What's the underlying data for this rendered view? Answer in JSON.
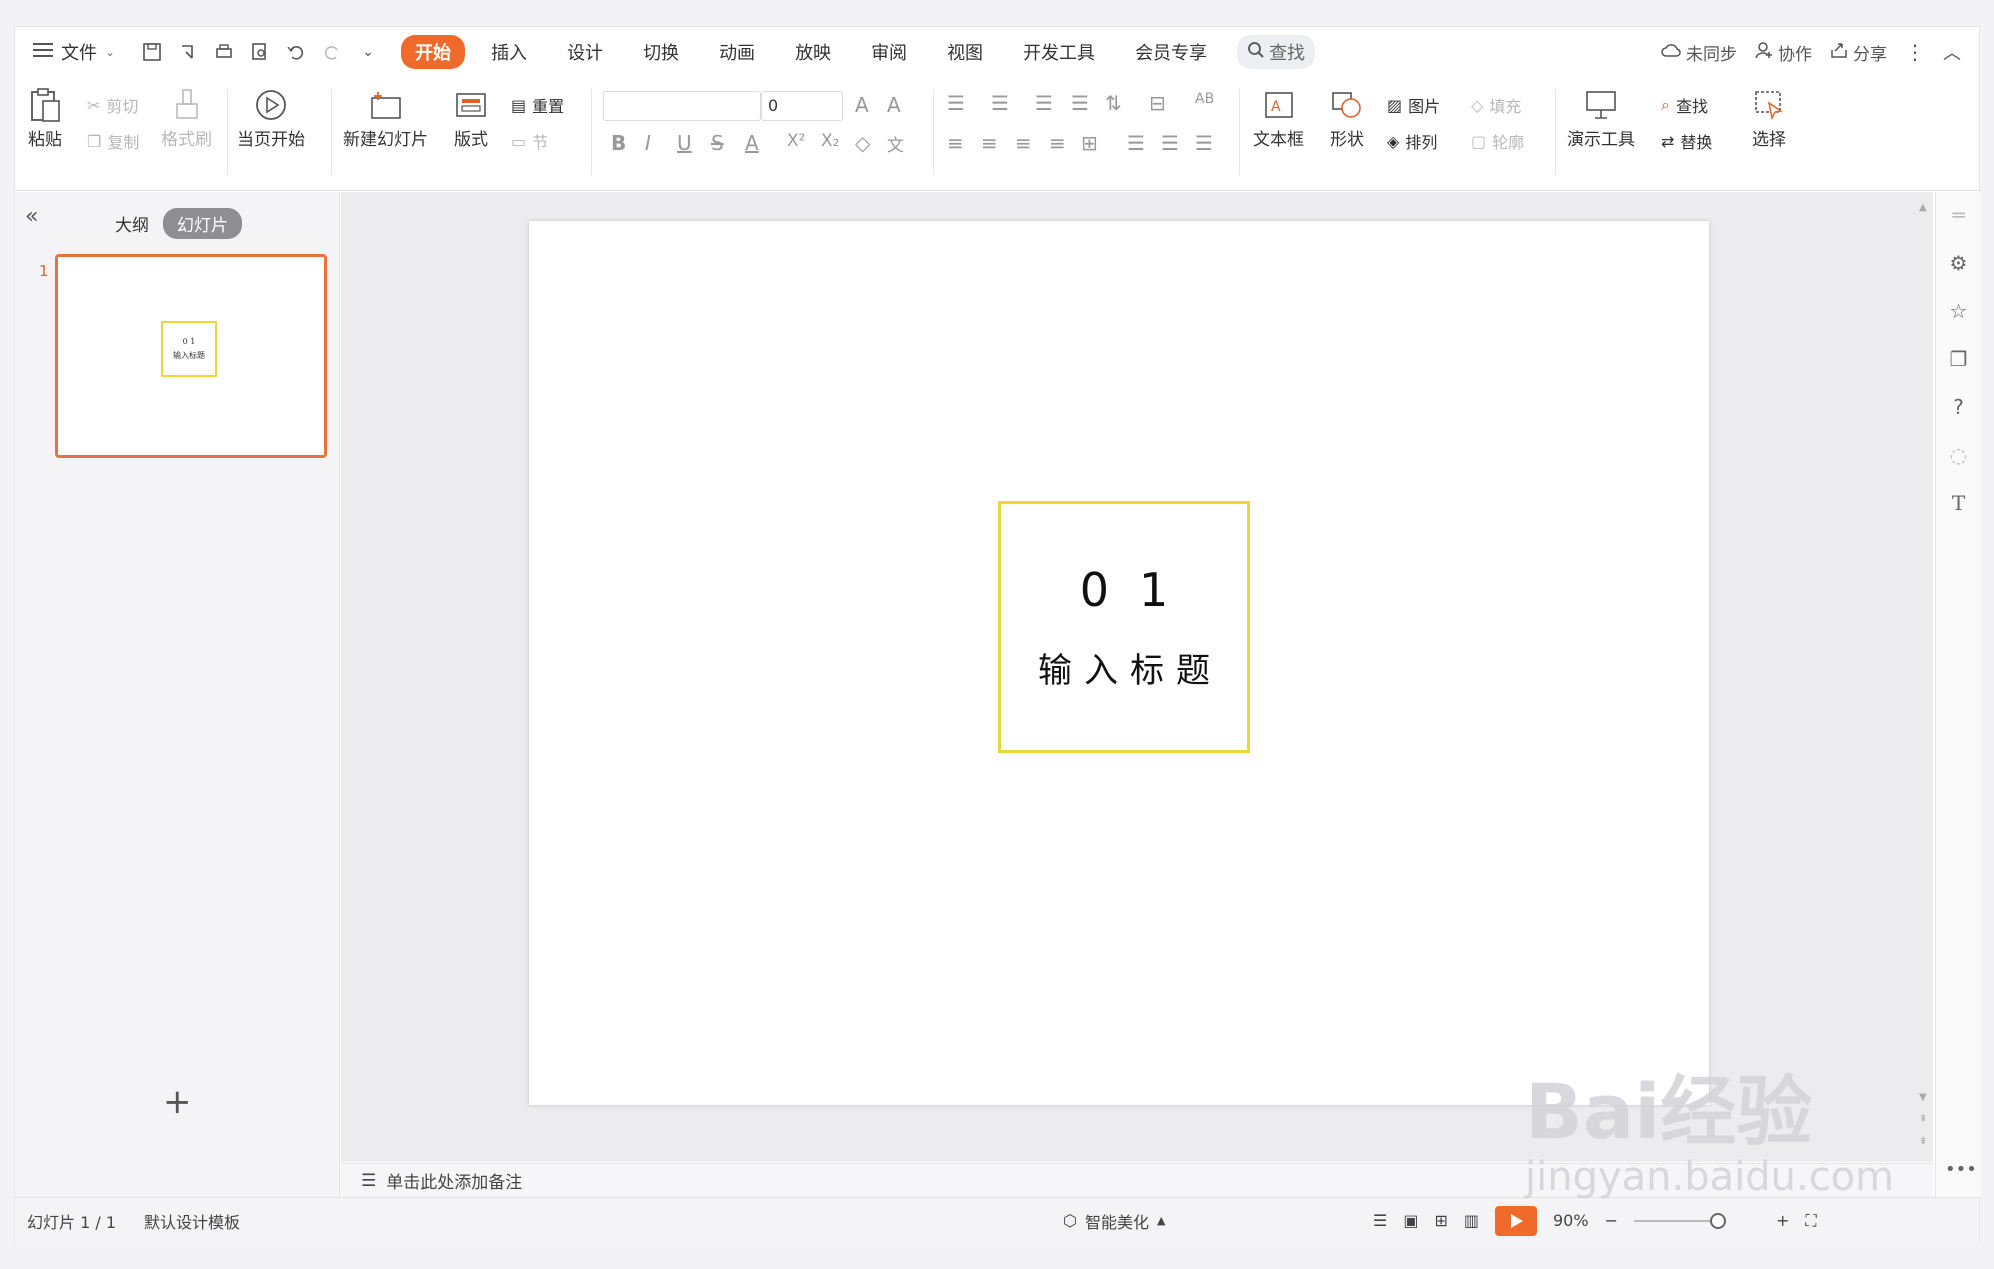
{
  "menubar": {
    "file_label": "文件",
    "tabs": [
      "开始",
      "插入",
      "设计",
      "切换",
      "动画",
      "放映",
      "审阅",
      "视图",
      "开发工具",
      "会员专享"
    ],
    "search_label": "查找",
    "right": {
      "sync": "未同步",
      "collab": "协作",
      "share": "分享"
    }
  },
  "ribbon": {
    "paste": "粘贴",
    "cut": "剪切",
    "copy": "复制",
    "format_painter": "格式刷",
    "play_from_current": "当页开始",
    "new_slide": "新建幻灯片",
    "layout": "版式",
    "reset": "重置",
    "section": "节",
    "font_size_value": "0",
    "textbox": "文本框",
    "shape": "形状",
    "picture": "图片",
    "fill": "填充",
    "arrange": "排列",
    "outline": "轮廓",
    "presentation_tools": "演示工具",
    "find": "查找",
    "replace": "替换",
    "select": "选择"
  },
  "leftpane": {
    "tab_outline": "大纲",
    "tab_slides": "幻灯片",
    "slide_number": "1",
    "thumb_num": "0 1",
    "thumb_title": "输入标题"
  },
  "slide": {
    "number_text": "01",
    "title_text": "输入标题",
    "border_color": "#ECD63C"
  },
  "notes": {
    "placeholder": "单击此处添加备注"
  },
  "status": {
    "slide_counter": "幻灯片 1 / 1",
    "template": "默认设计模板",
    "beautify": "智能美化",
    "zoom": "90%"
  },
  "watermark": {
    "line1": "Bai经验",
    "line2": "jingyan.baidu.com"
  },
  "colors": {
    "accent": "#F06A2C",
    "thumb_border": "#E8733E"
  }
}
